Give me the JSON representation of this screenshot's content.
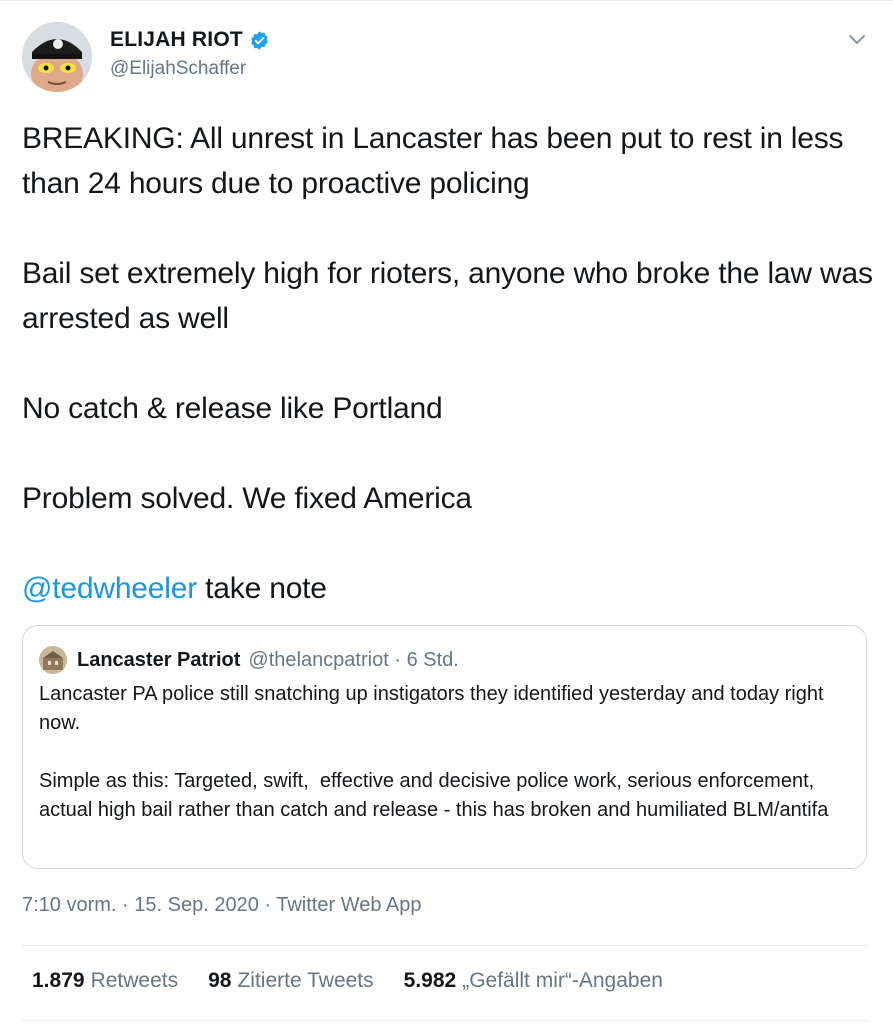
{
  "author": {
    "name": "ELIJAH RIOT",
    "handle": "@ElijahSchaffer",
    "verified": true
  },
  "tweet": {
    "text_main": "BREAKING: All unrest in Lancaster has been put to rest in less than 24 hours due to proactive policing\n\nBail set extremely high for rioters, anyone who broke the law was arrested as well\n\nNo catch & release like Portland\n\nProblem solved. We fixed America\n\n",
    "mention": "@tedwheeler",
    "text_after_mention": " take note"
  },
  "quote": {
    "name": "Lancaster Patriot",
    "handle": "@thelancpatriot",
    "separator": " · ",
    "time": "6 Std.",
    "text": "Lancaster PA police still snatching up instigators they identified yesterday and today right now.\n\nSimple as this: Targeted, swift,  effective and decisive police work, serious enforcement, actual high bail rather than catch and release - this has broken and humiliated BLM/antifa"
  },
  "meta": {
    "time": "7:10 vorm.",
    "date": "15. Sep. 2020",
    "separator": " · ",
    "app": "Twitter Web App"
  },
  "stats": {
    "retweets_count": "1.879",
    "retweets_label": "Retweets",
    "quotes_count": "98",
    "quotes_label": "Zitierte Tweets",
    "likes_count": "5.982",
    "likes_label": "„Gefällt mir“-Angaben"
  },
  "colors": {
    "link": "#1b95e0",
    "muted": "#657786",
    "border": "#ccd6dd",
    "verified": "#1da1f2"
  }
}
